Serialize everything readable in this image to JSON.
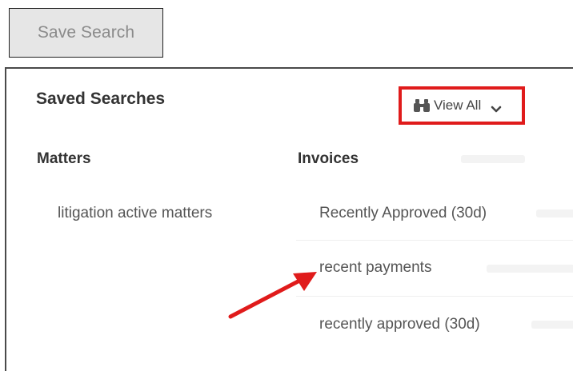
{
  "toolbar": {
    "save_search_label": "Save Search"
  },
  "panel": {
    "title": "Saved Searches",
    "view_all_label": "View All",
    "view_all_icon": "binoculars-icon",
    "dropdown_icon": "chevron-down-icon",
    "highlight_color": "#e01b1b"
  },
  "columns": {
    "matters": {
      "heading": "Matters",
      "items": [
        "litigation active matters"
      ]
    },
    "invoices": {
      "heading": "Invoices",
      "items": [
        "Recently Approved (30d)",
        "recent payments",
        "recently approved (30d)"
      ]
    }
  },
  "annotation": {
    "arrow_color": "#e01b1b"
  }
}
